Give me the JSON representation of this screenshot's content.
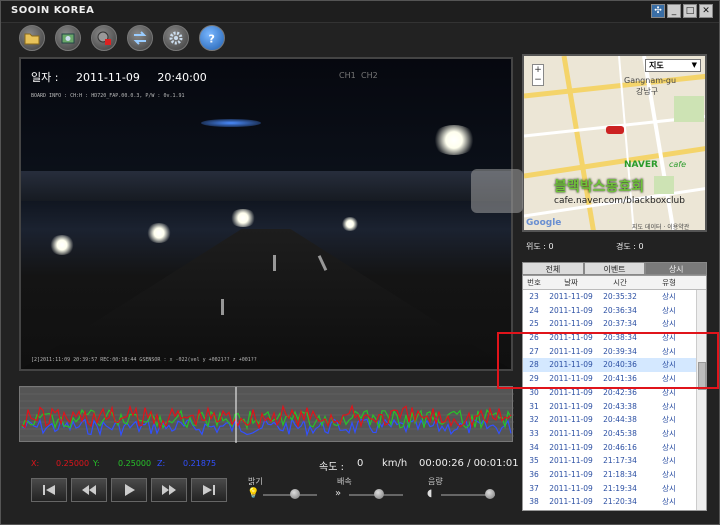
{
  "window": {
    "title": "SOOIN KOREA",
    "buttons": [
      "settings-icon",
      "minimize-icon",
      "maximize-icon",
      "close-icon"
    ]
  },
  "toolbar": {
    "items": [
      "folder-icon",
      "photo-icon",
      "delete-icon",
      "swap-icon",
      "gear-icon",
      "help-icon"
    ]
  },
  "video": {
    "date_label": "일자 :",
    "date": "2011-11-09",
    "time": "20:40:00",
    "ch1": "CH1",
    "ch2": "CH2",
    "osd_top": "BOARD INFO : CH:H : HD720_FAP.00.0.3, P/W : 0v.1.91",
    "osd_bottom": "[2]2011:11:09        20:39:57  REC:00:18:44  GSENSOR : x -022(vel y +0021?? z +001??"
  },
  "gsensor": {
    "x_label": "X:",
    "x_value": "0.25000",
    "y_label": "Y:",
    "y_value": "0.25000",
    "z_label": "Z:",
    "z_value": "0.21875"
  },
  "playback": {
    "speed_label": "속도 :",
    "speed_value": "0",
    "speed_unit": "km/h",
    "elapsed": "00:00:26 / 00:01:01"
  },
  "sliders": {
    "brightness_label": "밝기",
    "speed_label": "배속",
    "volume_label": "음량",
    "brightness_level": 0.6,
    "speed_level": 0.55,
    "volume_level": 0.9
  },
  "map": {
    "dropdown": "지도",
    "district_en": "Gangnam-gu",
    "district_kr": "강남구",
    "naver": "NAVER",
    "cafe": "cafe",
    "watermark_kr": "블랙박스동호회",
    "watermark_url": "cafe.naver.com/blackboxclub",
    "google": "Google",
    "terms": "지도 데이터 · 이용약관"
  },
  "coords": {
    "lat_label": "위도 : 0",
    "lng_label": "경도 : 0"
  },
  "tabs": [
    {
      "label": "전체"
    },
    {
      "label": "이벤트"
    },
    {
      "label": "상시"
    }
  ],
  "list": {
    "headers": [
      "번호",
      "날짜",
      "시간",
      "유형"
    ],
    "rows": [
      [
        "23",
        "2011-11-09",
        "20:35:32",
        "상시"
      ],
      [
        "24",
        "2011-11-09",
        "20:36:34",
        "상시"
      ],
      [
        "25",
        "2011-11-09",
        "20:37:34",
        "상시"
      ],
      [
        "26",
        "2011-11-09",
        "20:38:34",
        "상시"
      ],
      [
        "27",
        "2011-11-09",
        "20:39:34",
        "상시"
      ],
      [
        "28",
        "2011-11-09",
        "20:40:36",
        "상시"
      ],
      [
        "29",
        "2011-11-09",
        "20:41:36",
        "상시"
      ],
      [
        "30",
        "2011-11-09",
        "20:42:36",
        "상시"
      ],
      [
        "31",
        "2011-11-09",
        "20:43:38",
        "상시"
      ],
      [
        "32",
        "2011-11-09",
        "20:44:38",
        "상시"
      ],
      [
        "33",
        "2011-11-09",
        "20:45:38",
        "상시"
      ],
      [
        "34",
        "2011-11-09",
        "20:46:16",
        "상시"
      ],
      [
        "35",
        "2011-11-09",
        "21:17:34",
        "상시"
      ],
      [
        "36",
        "2011-11-09",
        "21:18:34",
        "상시"
      ],
      [
        "37",
        "2011-11-09",
        "21:19:34",
        "상시"
      ],
      [
        "38",
        "2011-11-09",
        "21:20:34",
        "상시"
      ]
    ],
    "selected_row": 5
  },
  "colors": {
    "x": "#e0141b",
    "y": "#27c22a",
    "z": "#3250ff",
    "highlight": "#e0141b"
  }
}
